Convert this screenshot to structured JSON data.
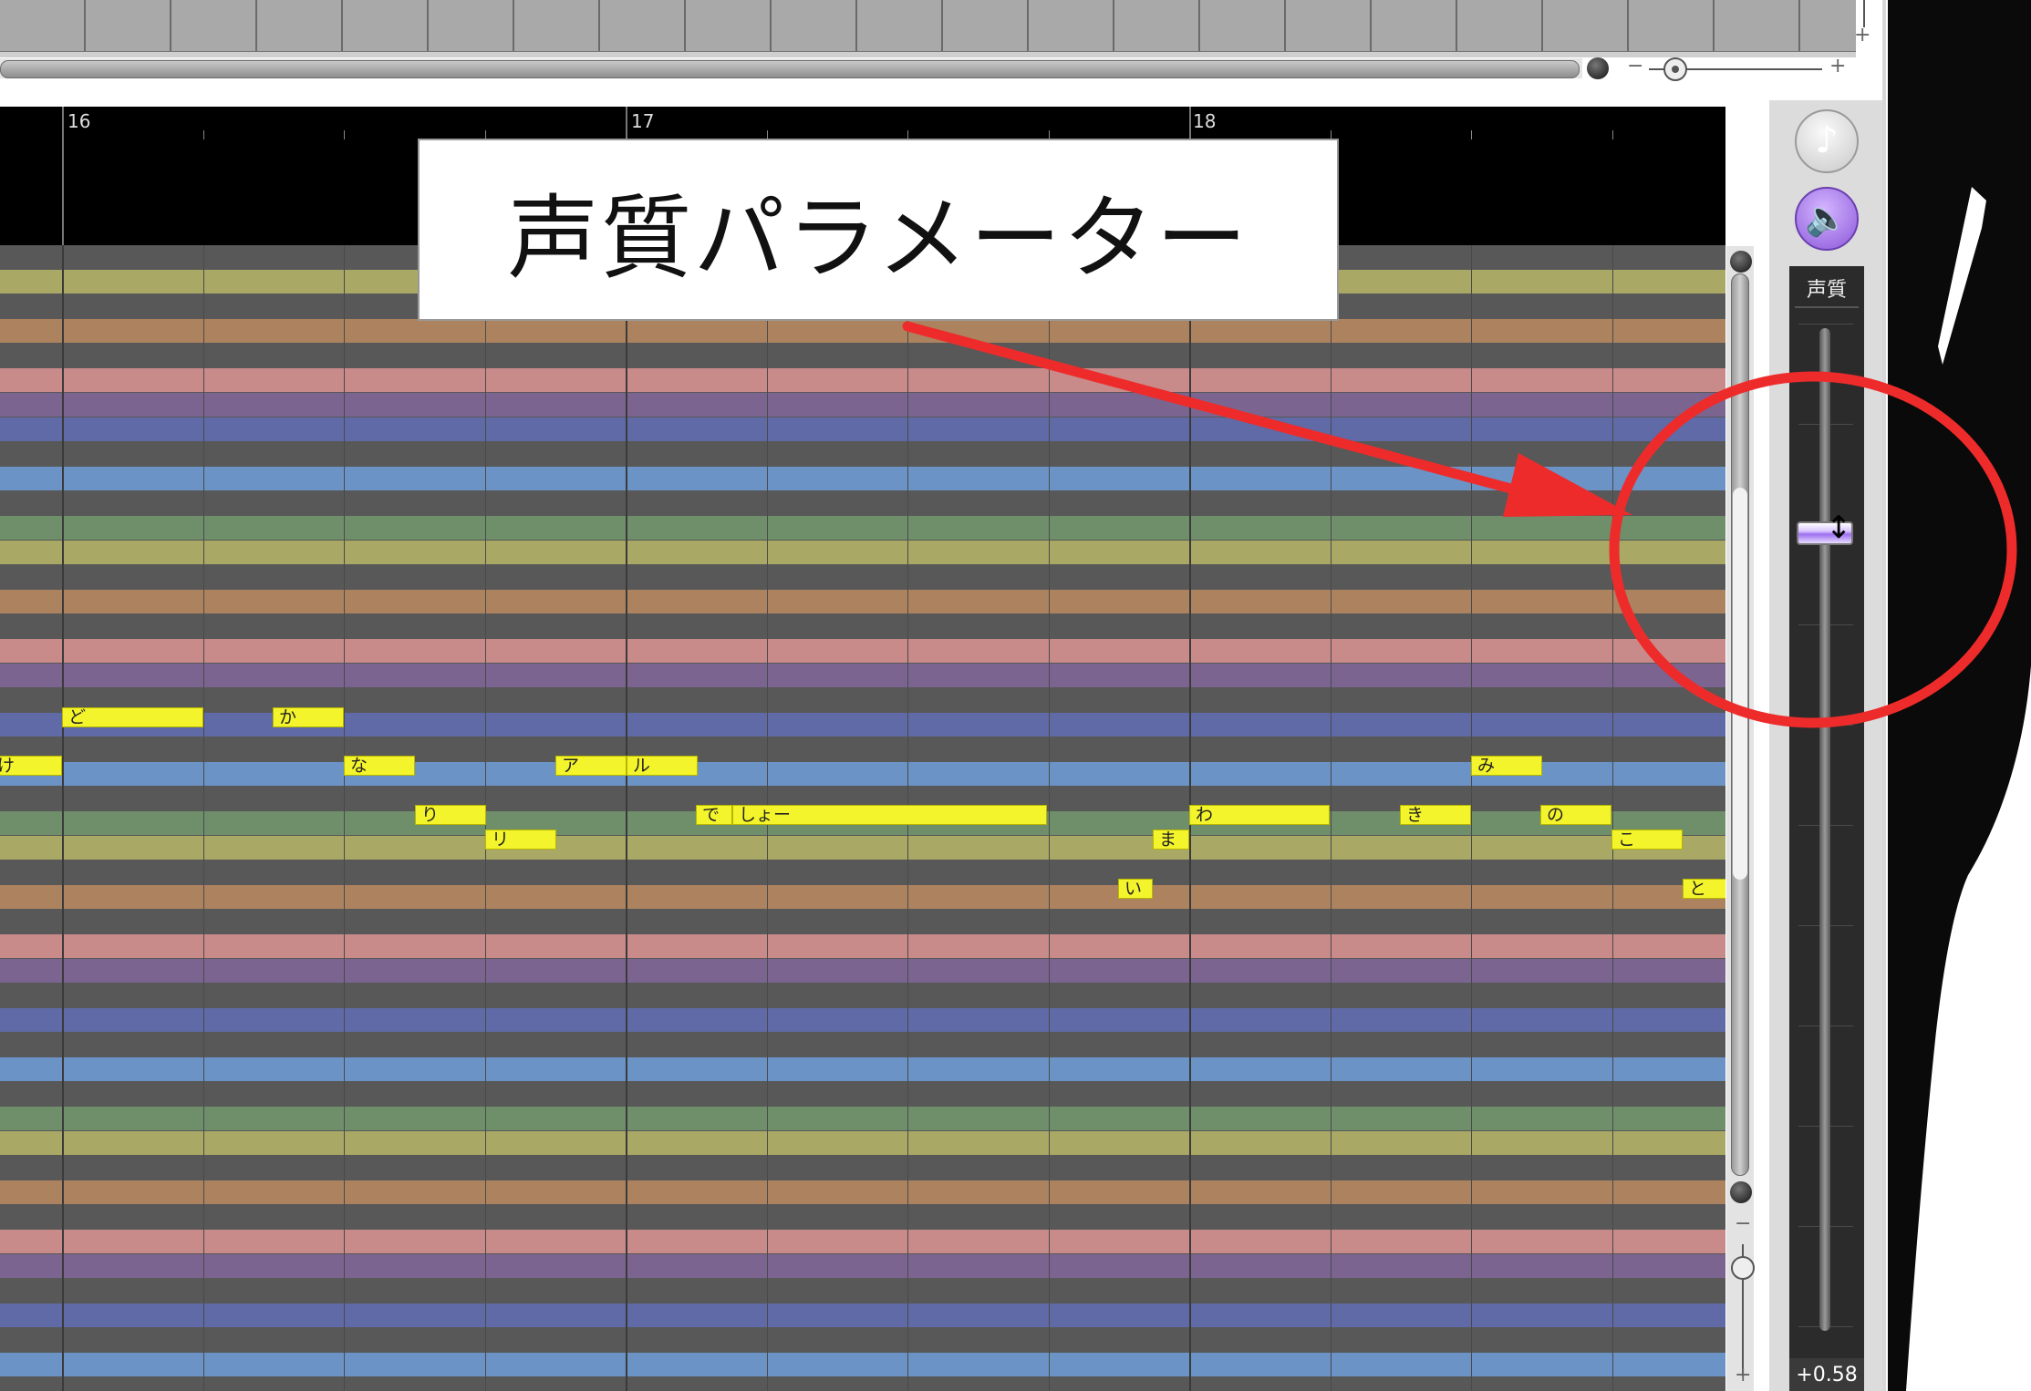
{
  "ruler": {
    "measures": [
      "16",
      "17",
      "18"
    ]
  },
  "annotation": {
    "callout_text": "声質パラメーター"
  },
  "lane_colors": [
    "#585858",
    "#a9a865",
    "#585858",
    "#ad835f",
    "#585858",
    "#c98a8a",
    "#7b648f",
    "#5f6aa6",
    "#585858",
    "#6b93c6",
    "#585858",
    "#6e8f6a",
    "#a9a865",
    "#585858",
    "#ad835f",
    "#585858",
    "#c98a8a",
    "#7b648f",
    "#585858",
    "#5f6aa6",
    "#585858",
    "#6b93c6",
    "#585858",
    "#6e8f6a",
    "#a9a865",
    "#585858",
    "#ad835f",
    "#585858",
    "#c98a8a",
    "#7b648f",
    "#585858",
    "#5f6aa6",
    "#585858",
    "#6b93c6",
    "#585858",
    "#6e8f6a",
    "#a9a865",
    "#585858",
    "#ad835f",
    "#585858",
    "#c98a8a",
    "#7b648f",
    "#585858",
    "#5f6aa6",
    "#585858",
    "#6b93c6",
    "#585858"
  ],
  "notes": [
    {
      "lyric": "け"
    },
    {
      "lyric": "ど"
    },
    {
      "lyric": "か"
    },
    {
      "lyric": "な"
    },
    {
      "lyric": "り"
    },
    {
      "lyric": "リ"
    },
    {
      "lyric": "ア"
    },
    {
      "lyric": "ル"
    },
    {
      "lyric": "で"
    },
    {
      "lyric": "しょー"
    },
    {
      "lyric": "い"
    },
    {
      "lyric": "ま"
    },
    {
      "lyric": "わ"
    },
    {
      "lyric": "き"
    },
    {
      "lyric": "み"
    },
    {
      "lyric": "の"
    },
    {
      "lyric": "こ"
    },
    {
      "lyric": "と"
    }
  ],
  "param_panel": {
    "title": "声質",
    "value": "+0.58",
    "note_icon": "♪",
    "speaker_icon": "🔈"
  },
  "zoom": {
    "minus": "−",
    "plus": "+"
  },
  "colors": {
    "note_fill": "#f4f42c",
    "annotation_red": "#ee2b2b",
    "slider_accent": "#9d6ef0"
  }
}
